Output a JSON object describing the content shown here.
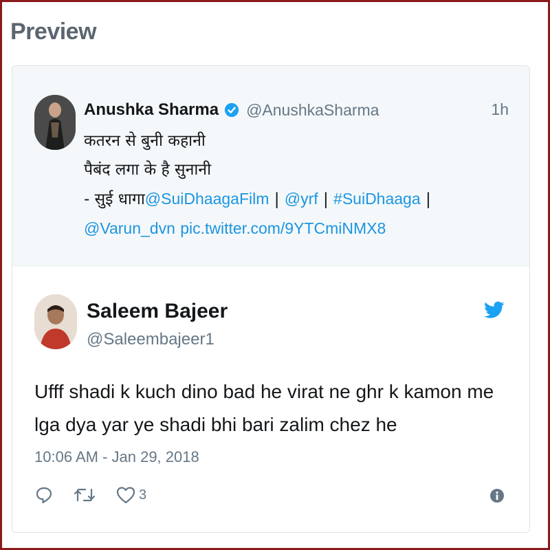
{
  "header": {
    "title": "Preview"
  },
  "quoted_tweet": {
    "name": "Anushka Sharma",
    "handle": "@AnushkaSharma",
    "time": "1h",
    "lines": [
      "कतरन से बुनी कहानी",
      "पैबंद लगा के है सुनानी"
    ],
    "prefix": "- सुई धागा",
    "mentions": {
      "sui": "@SuiDhaagaFilm",
      "yrf": "@yrf",
      "hashtag": "#SuiDhaaga",
      "varun": "@Varun_dvn",
      "pic": "pic.twitter.com/9YTCmiNMX8"
    },
    "separator": "|"
  },
  "reply_tweet": {
    "name": "Saleem Bajeer",
    "handle": "@Saleembajeer1",
    "text": "Ufff shadi k kuch dino bad he virat ne ghr k kamon me lga dya yar ye shadi bhi bari zalim chez he",
    "timestamp": "10:06 AM - Jan 29, 2018",
    "like_count": "3"
  },
  "colors": {
    "border": "#8b1a1a",
    "link": "#1b95e0",
    "twitter_blue": "#1da1f2",
    "muted": "#657786"
  },
  "icons": [
    "verified-badge-icon",
    "twitter-bird-icon",
    "reply-icon",
    "retweet-icon",
    "like-icon",
    "info-icon"
  ]
}
